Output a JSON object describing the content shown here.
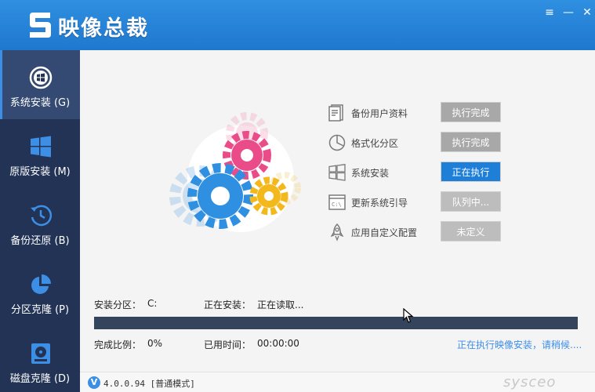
{
  "app": {
    "title": "映像总裁"
  },
  "window_controls": {
    "menu": "≡",
    "minimize": "—",
    "close": "✕"
  },
  "sidebar": {
    "items": [
      {
        "label": "系统安装 (G)",
        "icon": "windows-disc-icon",
        "active": true
      },
      {
        "label": "原版安装 (M)",
        "icon": "windows-logo-icon",
        "active": false
      },
      {
        "label": "备份还原 (B)",
        "icon": "history-clock-icon",
        "active": false
      },
      {
        "label": "分区克隆 (P)",
        "icon": "pie-chart-icon",
        "active": false
      },
      {
        "label": "磁盘克隆 (D)",
        "icon": "disk-icon",
        "active": false
      }
    ]
  },
  "steps": [
    {
      "label": "备份用户资料",
      "status": "执行完成",
      "icon": "document-icon"
    },
    {
      "label": "格式化分区",
      "status": "执行完成",
      "icon": "pie-chart-icon"
    },
    {
      "label": "系统安装",
      "status": "正在执行",
      "icon": "windows-logo-icon"
    },
    {
      "label": "更新系统引导",
      "status": "队列中...",
      "icon": "console-icon"
    },
    {
      "label": "应用自定义配置",
      "status": "未定义",
      "icon": "rocket-icon"
    }
  ],
  "install": {
    "partition_label": "安装分区：",
    "partition_value": "C:",
    "installing_label": "正在安装：",
    "installing_value": "正在读取...",
    "ratio_label": "完成比例：",
    "ratio_value": "0%",
    "elapsed_label": "已用时间：",
    "elapsed_value": "00:00:00",
    "progress": 0,
    "status_message": "正在执行映像安装，请稍候...."
  },
  "statusbar": {
    "badge": "V",
    "version": "4.0.0.94 [普通模式]",
    "watermark": "sysceo"
  },
  "colors": {
    "titlebar": "#2485d8",
    "sidebar": "#223356",
    "sidebar_active": "#344a72",
    "accent": "#3d8fe6",
    "progress_track": "#34445c"
  }
}
